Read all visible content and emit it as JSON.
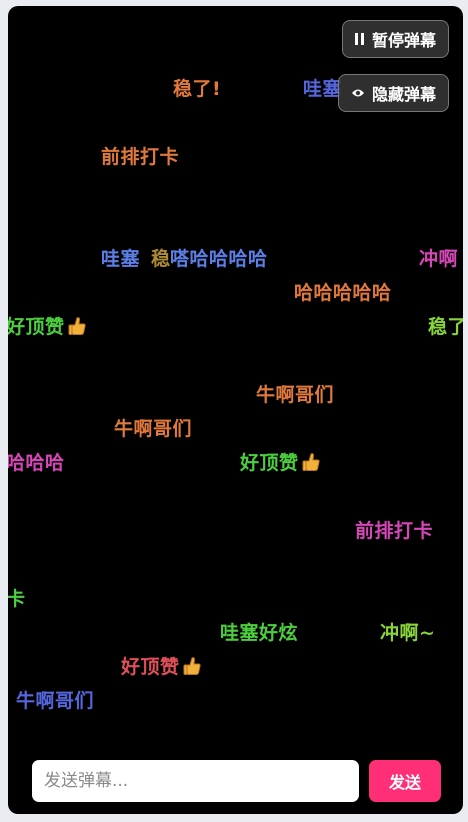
{
  "controls": {
    "pause_label": "暂停弹幕",
    "hide_label": "隐藏弹幕"
  },
  "danmaku": [
    {
      "text": "稳了!",
      "color": "#e0793b"
    },
    {
      "text": "哇塞",
      "color": "#5566dd"
    },
    {
      "text": "前排打卡",
      "color": "#e0793b"
    },
    {
      "text": "哇塞",
      "color": "#5c7fe6"
    },
    {
      "text": "稳",
      "color": "#c9a33b"
    },
    {
      "text": "嗒哈哈哈哈",
      "color": "#5c7fe6"
    },
    {
      "text": "冲啊",
      "color": "#d546b7"
    },
    {
      "text": "哈哈哈哈哈",
      "color": "#e0793b"
    },
    {
      "text": "好顶赞",
      "color": "#4ccf3e",
      "emoji": "thumbs-up"
    },
    {
      "text": "稳了",
      "color": "#88d43a"
    },
    {
      "text": "牛啊哥们",
      "color": "#e0793b"
    },
    {
      "text": "牛啊哥们",
      "color": "#e0793b"
    },
    {
      "text": "哈哈哈",
      "color": "#d546b7"
    },
    {
      "text": "好顶赞",
      "color": "#4ccf3e",
      "emoji": "thumbs-up"
    },
    {
      "text": "前排打卡",
      "color": "#d546b7"
    },
    {
      "text": "卡",
      "color": "#4ccf3e"
    },
    {
      "text": "哇塞好炫",
      "color": "#4ccf3e"
    },
    {
      "text": "冲啊~",
      "color": "#88d43a"
    },
    {
      "text": "好顶赞",
      "color": "#e0505a",
      "emoji": "thumbs-up"
    },
    {
      "text": "牛啊哥们",
      "color": "#5566dd"
    }
  ],
  "input": {
    "placeholder": "发送弹幕...",
    "send_label": "发送"
  }
}
